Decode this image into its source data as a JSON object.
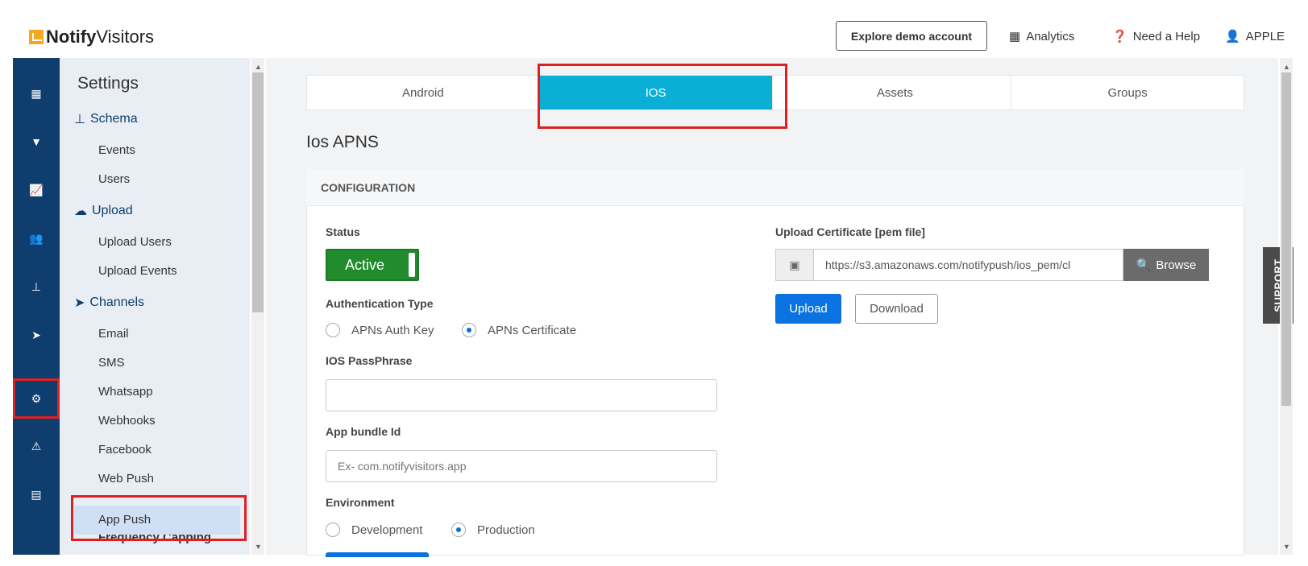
{
  "brand": {
    "bold": "Notify",
    "rest": "Visitors"
  },
  "topbar": {
    "explore_label": "Explore demo account",
    "analytics_label": "Analytics",
    "help_label": "Need a Help",
    "user_label": "APPLE"
  },
  "sidebar": {
    "title": "Settings",
    "sections": {
      "schema": "Schema",
      "upload": "Upload",
      "channels": "Channels"
    },
    "items": {
      "events": "Events",
      "users": "Users",
      "upload_users": "Upload Users",
      "upload_events": "Upload Events",
      "email": "Email",
      "sms": "SMS",
      "whatsapp": "Whatsapp",
      "webhooks": "Webhooks",
      "facebook": "Facebook",
      "web_push": "Web Push",
      "app_push": "App Push",
      "frequency_capping": "Frequency Capping"
    }
  },
  "tabs": {
    "android": "Android",
    "ios": "IOS",
    "assets": "Assets",
    "groups": "Groups"
  },
  "main": {
    "title": "Ios APNS",
    "card_header": "CONFIGURATION",
    "status_label": "Status",
    "status_value": "Active",
    "auth_type_label": "Authentication Type",
    "auth_options": {
      "key": "APNs Auth Key",
      "cert": "APNs Certificate"
    },
    "passphrase_label": "IOS PassPhrase",
    "bundle_label": "App bundle Id",
    "bundle_placeholder": "Ex- com.notifyvisitors.app",
    "environment_label": "Environment",
    "env_options": {
      "dev": "Development",
      "prod": "Production"
    },
    "upload_cert_label": "Upload Certificate [pem file]",
    "cert_url": "https://s3.amazonaws.com/notifypush/ios_pem/cl",
    "browse_label": "Browse",
    "upload_label": "Upload",
    "download_label": "Download"
  },
  "support_label": "SUPPORT",
  "colors": {
    "navy": "#0f3d6e",
    "active_tab": "#0aafd6",
    "active_toggle": "#218b2d",
    "primary": "#0a73e0",
    "highlight": "#e02020"
  },
  "icons": {
    "nav": [
      "grid-icon",
      "filter-icon",
      "line-chart-icon",
      "users-icon",
      "sitemap-icon",
      "paper-plane-icon",
      "gear-icon",
      "warning-icon",
      "document-icon"
    ]
  }
}
